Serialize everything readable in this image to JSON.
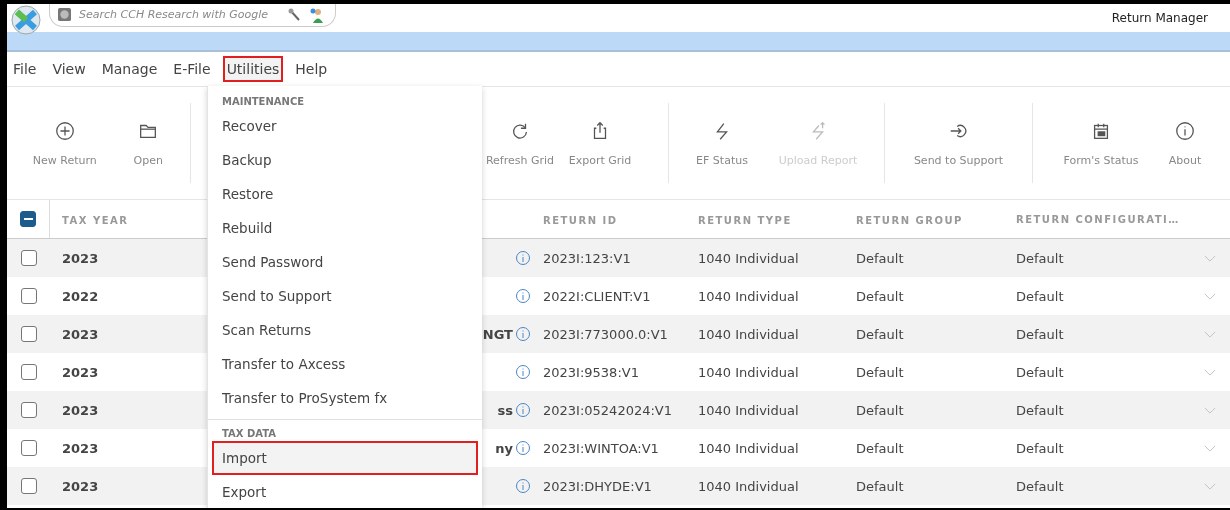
{
  "window": {
    "title": "Return Manager"
  },
  "search": {
    "placeholder": "Search CCH Research with Google"
  },
  "menu_bar": [
    {
      "label": "File",
      "selected": false
    },
    {
      "label": "View",
      "selected": false
    },
    {
      "label": "Manage",
      "selected": false
    },
    {
      "label": "E-File",
      "selected": false
    },
    {
      "label": "Utilities",
      "selected": true
    },
    {
      "label": "Help",
      "selected": false
    }
  ],
  "toolbar": {
    "groups": [
      [
        {
          "label": "New Return",
          "kind": "new",
          "disabled": false
        },
        {
          "label": "Open",
          "kind": "open",
          "disabled": false
        }
      ],
      [
        {
          "label": "Refresh Grid",
          "kind": "refresh",
          "disabled": false
        },
        {
          "label": "Export Grid",
          "kind": "export",
          "disabled": false
        }
      ],
      [
        {
          "label": "EF Status",
          "kind": "status",
          "disabled": false
        },
        {
          "label": "Upload Report",
          "kind": "upload",
          "disabled": true
        }
      ],
      [
        {
          "label": "Send to Support",
          "kind": "support",
          "disabled": false
        }
      ],
      [
        {
          "label": "Form's Status",
          "kind": "forms",
          "disabled": false
        },
        {
          "label": "About",
          "kind": "about",
          "disabled": false
        }
      ]
    ]
  },
  "utilities_menu": {
    "sections": [
      {
        "heading": "MAINTENANCE",
        "items": [
          {
            "label": "Recover",
            "highlighted": false
          },
          {
            "label": "Backup",
            "highlighted": false
          },
          {
            "label": "Restore",
            "highlighted": false
          },
          {
            "label": "Rebuild",
            "highlighted": false
          },
          {
            "label": "Send Password",
            "highlighted": false
          },
          {
            "label": "Send to Support",
            "highlighted": false
          },
          {
            "label": "Scan Returns",
            "highlighted": false
          },
          {
            "label": "Transfer to Axcess",
            "highlighted": false
          },
          {
            "label": "Transfer to ProSystem fx",
            "highlighted": false
          }
        ]
      },
      {
        "heading": "TAX DATA",
        "items": [
          {
            "label": "Import",
            "highlighted": true
          },
          {
            "label": "Export",
            "highlighted": false
          }
        ]
      }
    ]
  },
  "table": {
    "select_all": {
      "indeterminate": true
    },
    "columns": {
      "tax_year": "TAX YEAR",
      "return_id": "RETURN ID",
      "return_type": "RETURN TYPE",
      "return_group": "RETURN GROUP",
      "return_configuration": "RETURN CONFIGURATI…"
    },
    "rows": [
      {
        "checked": false,
        "tax_year": "2023",
        "return_id": "2023I:123:V1",
        "return_type": "1040 Individual",
        "return_group": "Default",
        "return_configuration": "Default"
      },
      {
        "checked": false,
        "tax_year": "2022",
        "return_id": "2022I:CLIENT:V1",
        "return_type": "1040 Individual",
        "return_group": "Default",
        "return_configuration": "Default"
      },
      {
        "checked": false,
        "tax_year": "2023",
        "column_2": "NGT",
        "return_id": "2023I:773000.0:V1",
        "return_type": "1040 Individual",
        "return_group": "Default",
        "return_configuration": "Default"
      },
      {
        "checked": false,
        "tax_year": "2023",
        "return_id": "2023I:9538:V1",
        "return_type": "1040 Individual",
        "return_group": "Default",
        "return_configuration": "Default"
      },
      {
        "checked": false,
        "tax_year": "2023",
        "column_2": "ss",
        "return_id": "2023I:05242024:V1",
        "return_type": "1040 Individual",
        "return_group": "Default",
        "return_configuration": "Default"
      },
      {
        "checked": false,
        "tax_year": "2023",
        "column_2": "ny",
        "return_id": "2023I:WINTOA:V1",
        "return_type": "1040 Individual",
        "return_group": "Default",
        "return_configuration": "Default"
      },
      {
        "checked": false,
        "tax_year": "2023",
        "return_id": "2023I:DHYDE:V1",
        "return_type": "1040 Individual",
        "return_group": "Default",
        "return_configuration": "Default"
      }
    ]
  }
}
